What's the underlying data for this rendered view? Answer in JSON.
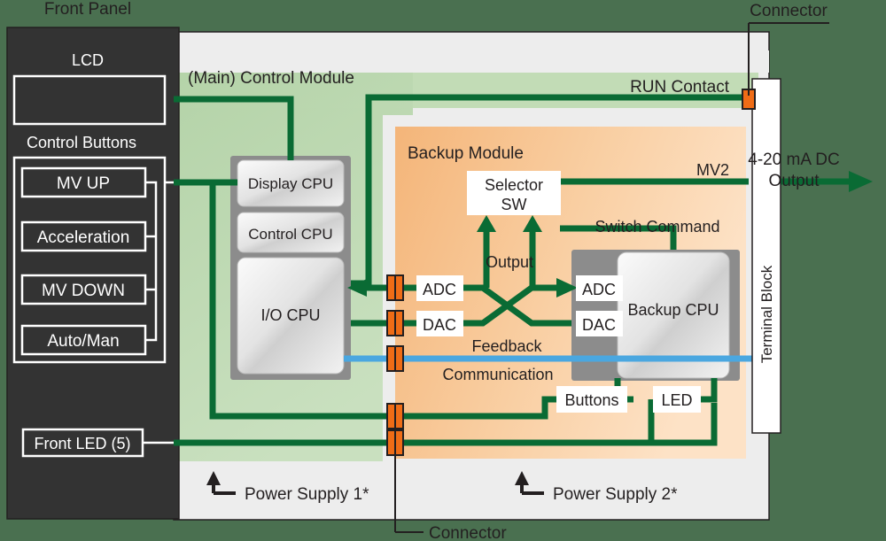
{
  "diagram": {
    "title": "Controller block diagram",
    "background_color": "#4a7050",
    "colors": {
      "background": "#4a7050",
      "front_panel": "#333333",
      "main_module": "#b9d6ae",
      "backup_module_dark": "#f3b87b",
      "backup_module_light": "#fbdfc2",
      "enclosure": "#ededed",
      "wire_green": "#0a6b34",
      "wire_blue": "#4aa7e0",
      "connector_orange": "#ef6c16",
      "chip_housing": "#8c8c8c",
      "chip_face": "#e6e6e6",
      "text_dark": "#231f20",
      "text_light": "#ffffff"
    }
  },
  "labels": {
    "front_panel": "Front Panel",
    "connector_top": "Connector",
    "connector_bottom": "Connector",
    "main_control_module": "(Main) Control Module",
    "backup_module": "Backup Module",
    "run_contact": "RUN Contact",
    "output_current": "4-20 mA DC\nOutput",
    "output_current_line1": "4-20 mA DC",
    "output_current_line2": "Output",
    "mv2": "MV2",
    "terminal_block": "Terminal Block",
    "switch_command": "Switch Command",
    "output": "Output",
    "feedback": "Feedback",
    "communication": "Communication",
    "power_supply_1": "Power Supply 1*",
    "power_supply_2": "Power Supply 2*"
  },
  "front_panel": {
    "lcd_label": "LCD",
    "control_buttons_label": "Control Buttons",
    "buttons": [
      {
        "label": "MV UP"
      },
      {
        "label": "Acceleration"
      },
      {
        "label": "MV DOWN"
      },
      {
        "label": "Auto/Man"
      }
    ],
    "front_led": "Front LED (5)"
  },
  "main_module": {
    "cpus": [
      {
        "label": "Display CPU"
      },
      {
        "label": "Control CPU"
      },
      {
        "label": "I/O CPU"
      }
    ]
  },
  "backup_module": {
    "selector_sw_line1": "Selector",
    "selector_sw_line2": "SW",
    "left_converters": [
      {
        "label": "ADC"
      },
      {
        "label": "DAC"
      }
    ],
    "right_converters": [
      {
        "label": "ADC"
      },
      {
        "label": "DAC"
      }
    ],
    "backup_cpu": "Backup CPU",
    "buttons": "Buttons",
    "led": "LED"
  }
}
